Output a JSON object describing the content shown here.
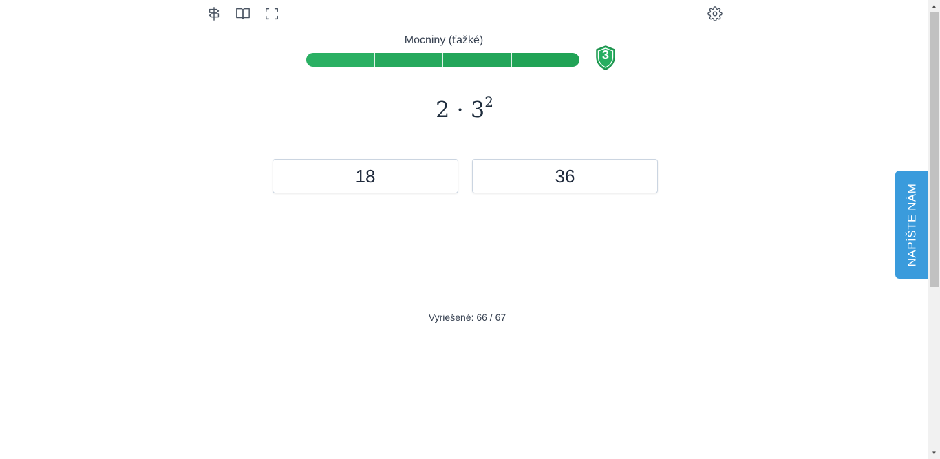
{
  "toolbar": {
    "icons": [
      "signpost-icon",
      "book-icon",
      "fullscreen-icon",
      "gear-icon"
    ]
  },
  "level": {
    "title": "Mocniny (ťažké)",
    "progress_fraction": 1.0,
    "segments": 4,
    "badge_number": "3",
    "accent_color": "#27ae60"
  },
  "problem": {
    "base_expression": "2 · 3",
    "exponent": "2"
  },
  "answers": [
    {
      "label": "18"
    },
    {
      "label": "36"
    }
  ],
  "status": {
    "solved_text": "Vyriešené: 66 / 67"
  },
  "feedback": {
    "label": "NAPÍŠTE NÁM",
    "color": "#3a9bdc"
  }
}
